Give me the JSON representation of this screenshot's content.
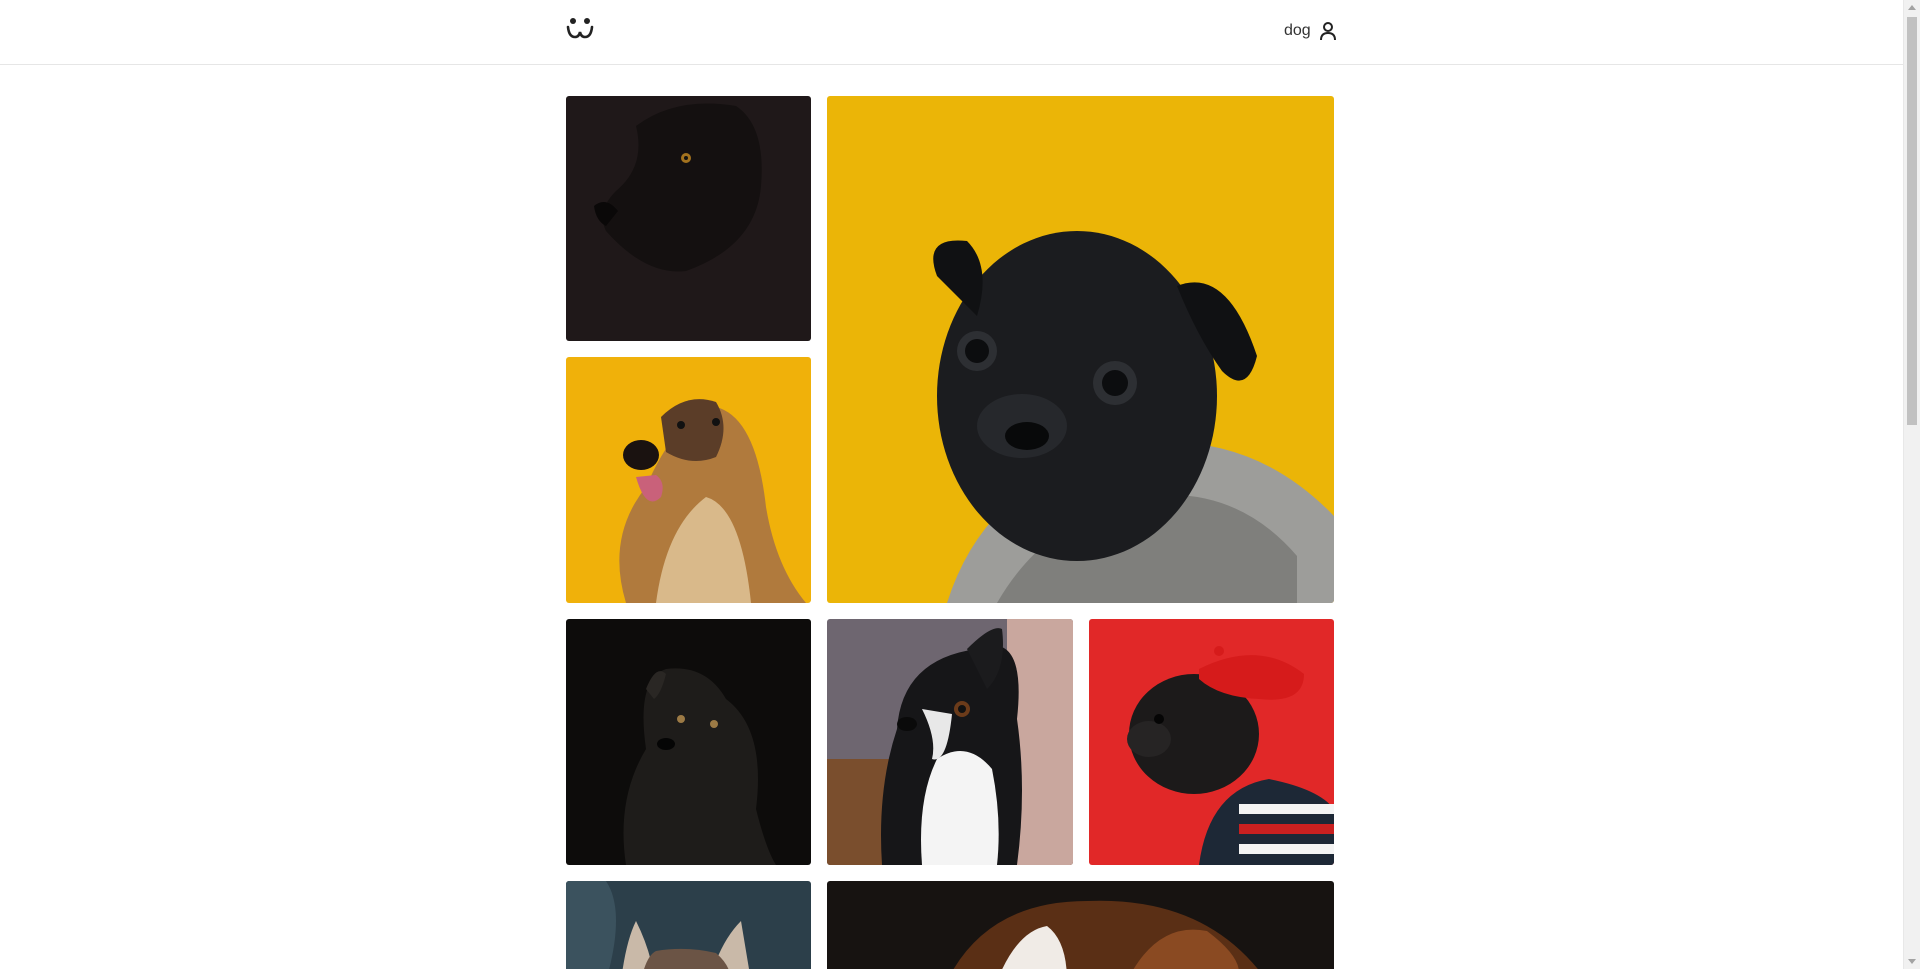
{
  "header": {
    "logo_icon": "paw-face-logo-icon",
    "username": "dog",
    "user_icon": "user-icon"
  },
  "gallery": {
    "photos": [
      {
        "subject": "black-dog-portrait",
        "background": "#1f1819"
      },
      {
        "subject": "black-pug-in-scarf",
        "background": "#ebb507"
      },
      {
        "subject": "afghan-hound",
        "background": "#f0b10a"
      },
      {
        "subject": "black-fluffy-dog",
        "background": "#0d0c0b"
      },
      {
        "subject": "boston-terrier",
        "background": "#6e6670"
      },
      {
        "subject": "pug-with-red-beret",
        "background": "#e12828"
      },
      {
        "subject": "husky-partial",
        "background": "#2c3f4a"
      },
      {
        "subject": "brown-white-dog-partial",
        "background": "#171311"
      }
    ]
  },
  "colors": {
    "header_border": "#e6e6e6",
    "text": "#333333"
  }
}
